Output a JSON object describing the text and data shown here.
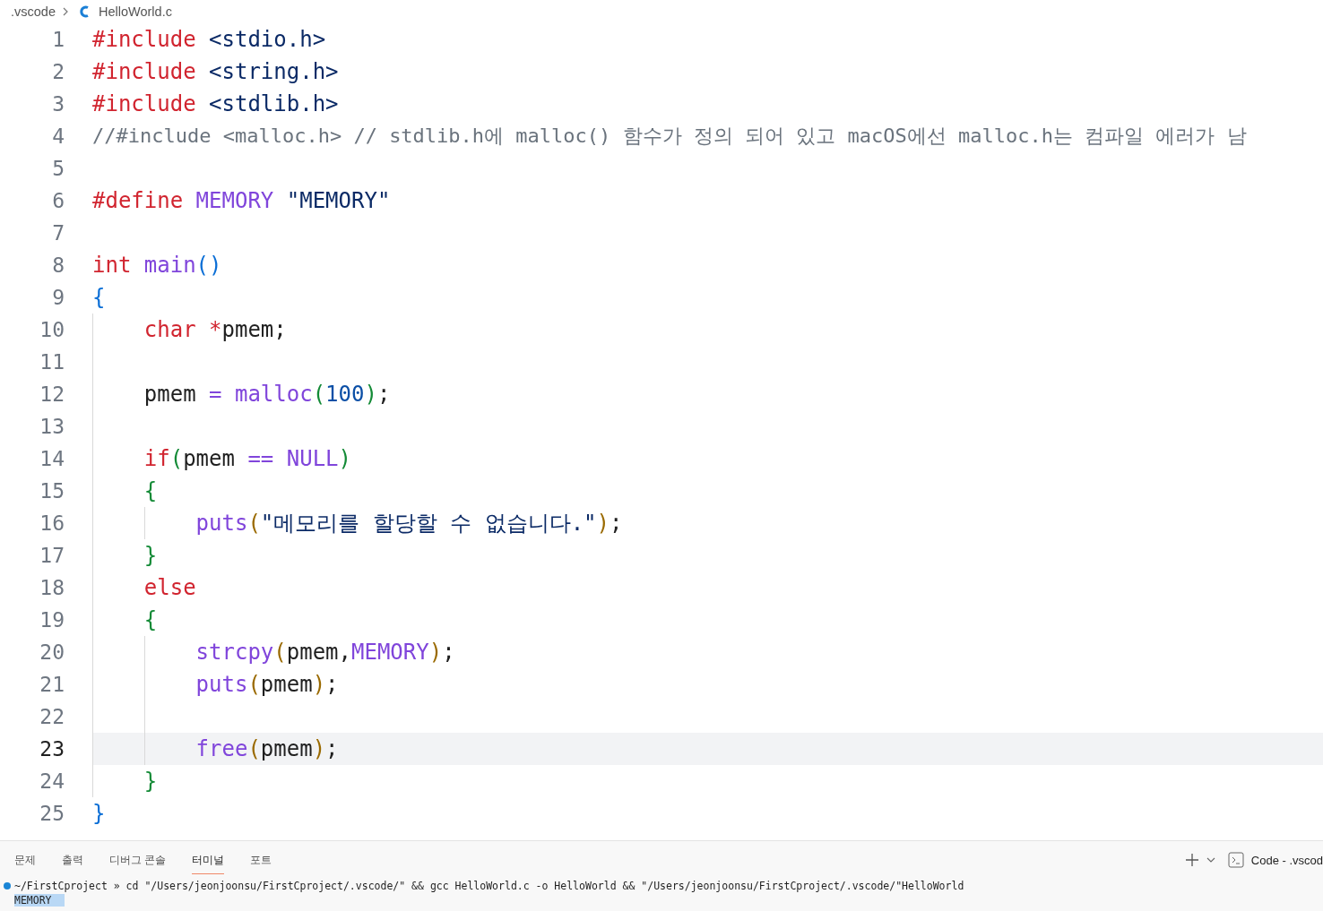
{
  "breadcrumb": {
    "folder": ".vscode",
    "file": "HelloWorld.c"
  },
  "editor": {
    "lines": [
      {
        "number": "1",
        "current": false,
        "tokens": [
          {
            "kind": "keyword",
            "text": "#include "
          },
          {
            "kind": "path",
            "text": "<stdio.h>"
          }
        ]
      },
      {
        "number": "2",
        "current": false,
        "tokens": [
          {
            "kind": "keyword",
            "text": "#include "
          },
          {
            "kind": "path",
            "text": "<string.h>"
          }
        ]
      },
      {
        "number": "3",
        "current": false,
        "tokens": [
          {
            "kind": "keyword",
            "text": "#include "
          },
          {
            "kind": "path",
            "text": "<stdlib.h>"
          }
        ]
      },
      {
        "number": "4",
        "current": false,
        "tokens": [
          {
            "kind": "comment",
            "text": "//#include <malloc.h> // stdlib.h에 malloc() 함수가 정의 되어 있고 macOS에선 malloc.h는 컴파일 에러가 남"
          }
        ]
      },
      {
        "number": "5",
        "current": false
      },
      {
        "number": "6",
        "current": false,
        "tokens": [
          {
            "kind": "keyword",
            "text": "#define "
          },
          {
            "kind": "macro",
            "text": "MEMORY "
          },
          {
            "kind": "string",
            "text": "\"MEMORY\""
          }
        ]
      },
      {
        "number": "7",
        "current": false
      },
      {
        "number": "8",
        "current": false,
        "tokens": [
          {
            "kind": "keyword",
            "text": "int "
          },
          {
            "kind": "function",
            "text": "main"
          },
          {
            "kind": "bracket1",
            "text": "()"
          }
        ]
      },
      {
        "number": "9",
        "current": false,
        "tokens": [
          {
            "kind": "bracket1",
            "text": "{"
          }
        ]
      },
      {
        "number": "10",
        "current": false,
        "tokens": [
          {
            "kind": "keyword",
            "text": "    char "
          },
          {
            "kind": "keyword",
            "text": "*"
          },
          {
            "kind": "plain",
            "text": "pmem;"
          }
        ]
      },
      {
        "number": "11",
        "current": false
      },
      {
        "number": "12",
        "current": false,
        "tokens": [
          {
            "kind": "plain",
            "text": "    pmem "
          },
          {
            "kind": "operator",
            "text": "= "
          },
          {
            "kind": "function",
            "text": "malloc"
          },
          {
            "kind": "bracket2",
            "text": "("
          },
          {
            "kind": "number",
            "text": "100"
          },
          {
            "kind": "bracket2",
            "text": ")"
          },
          {
            "kind": "plain",
            "text": ";"
          }
        ]
      },
      {
        "number": "13",
        "current": false
      },
      {
        "number": "14",
        "current": false,
        "tokens": [
          {
            "kind": "keyword",
            "text": "    if"
          },
          {
            "kind": "bracket2",
            "text": "("
          },
          {
            "kind": "plain",
            "text": "pmem "
          },
          {
            "kind": "operator",
            "text": "== "
          },
          {
            "kind": "macro",
            "text": "NULL"
          },
          {
            "kind": "bracket2",
            "text": ")"
          }
        ]
      },
      {
        "number": "15",
        "current": false,
        "tokens": [
          {
            "kind": "bracket2",
            "text": "    {"
          }
        ]
      },
      {
        "number": "16",
        "current": false,
        "tokens": [
          {
            "kind": "function",
            "text": "        puts"
          },
          {
            "kind": "bracket3",
            "text": "("
          },
          {
            "kind": "string",
            "text": "\"메모리를 할당할 수 없습니다.\""
          },
          {
            "kind": "bracket3",
            "text": ")"
          },
          {
            "kind": "plain",
            "text": ";"
          }
        ]
      },
      {
        "number": "17",
        "current": false,
        "tokens": [
          {
            "kind": "bracket2",
            "text": "    }"
          }
        ]
      },
      {
        "number": "18",
        "current": false,
        "tokens": [
          {
            "kind": "keyword",
            "text": "    else"
          }
        ]
      },
      {
        "number": "19",
        "current": false,
        "tokens": [
          {
            "kind": "bracket2",
            "text": "    {"
          }
        ]
      },
      {
        "number": "20",
        "current": false,
        "tokens": [
          {
            "kind": "function",
            "text": "        strcpy"
          },
          {
            "kind": "bracket3",
            "text": "("
          },
          {
            "kind": "plain",
            "text": "pmem,"
          },
          {
            "kind": "macro",
            "text": "MEMORY"
          },
          {
            "kind": "bracket3",
            "text": ")"
          },
          {
            "kind": "plain",
            "text": ";"
          }
        ]
      },
      {
        "number": "21",
        "current": false,
        "tokens": [
          {
            "kind": "function",
            "text": "        puts"
          },
          {
            "kind": "bracket3",
            "text": "("
          },
          {
            "kind": "plain",
            "text": "pmem"
          },
          {
            "kind": "bracket3",
            "text": ")"
          },
          {
            "kind": "plain",
            "text": ";"
          }
        ]
      },
      {
        "number": "22",
        "current": false
      },
      {
        "number": "23",
        "current": true,
        "tokens": [
          {
            "kind": "function",
            "text": "        free"
          },
          {
            "kind": "bracket3",
            "text": "("
          },
          {
            "kind": "plain",
            "text": "pmem"
          },
          {
            "kind": "bracket3",
            "text": ")"
          },
          {
            "kind": "plain",
            "text": ";"
          }
        ]
      },
      {
        "number": "24",
        "current": false,
        "tokens": [
          {
            "kind": "bracket2",
            "text": "    }"
          }
        ]
      },
      {
        "number": "25",
        "current": false,
        "tokens": [
          {
            "kind": "bracket1",
            "text": "}"
          }
        ]
      }
    ]
  },
  "panel": {
    "tabs": [
      {
        "label": "문제",
        "selected": false
      },
      {
        "label": "출력",
        "selected": false
      },
      {
        "label": "디버그 콘솔",
        "selected": false
      },
      {
        "label": "터미널",
        "selected": true
      },
      {
        "label": "포트",
        "selected": false
      }
    ],
    "terminal_name": "Code - .vscod",
    "terminal": [
      {
        "kind": "command",
        "text": "~/FirstCproject » cd \"/Users/jeonjoonsu/FirstCproject/.vscode/\" && gcc HelloWorld.c -o HelloWorld && \"/Users/jeonjoonsu/FirstCproject/.vscode/\"HelloWorld",
        "selected": false
      },
      {
        "kind": "output",
        "text": "MEMORY",
        "selected": true
      }
    ]
  }
}
